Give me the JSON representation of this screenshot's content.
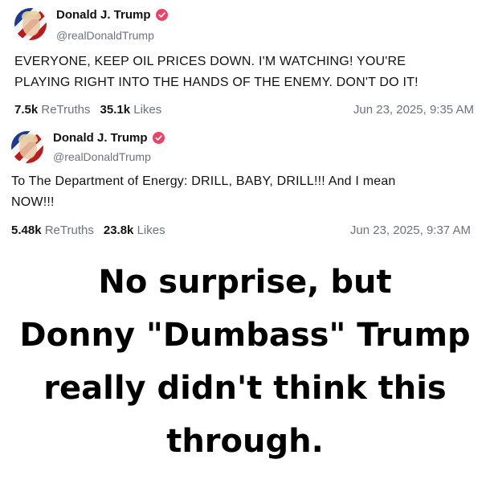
{
  "posts": [
    {
      "display_name": "Donald J. Trump",
      "handle": "@realDonaldTrump",
      "body_line1": "EVERYONE, KEEP OIL PRICES DOWN. I'M WATCHING! YOU'RE",
      "body_line2": "PLAYING RIGHT INTO THE HANDS OF THE ENEMY. DON'T DO IT!",
      "retruths_count": "7.5k",
      "retruths_label": "ReTruths",
      "likes_count": "35.1k",
      "likes_label": "Likes",
      "timestamp": "Jun 23, 2025, 9:35 AM"
    },
    {
      "display_name": "Donald J. Trump",
      "handle": "@realDonaldTrump",
      "body_line1": "To The Department of Energy: DRILL, BABY, DRILL!!!  And I mean",
      "body_line2": "NOW!!!",
      "retruths_count": "5.48k",
      "retruths_label": "ReTruths",
      "likes_count": "23.8k",
      "likes_label": "Likes",
      "timestamp": "Jun 23, 2025, 9:37 AM"
    }
  ],
  "caption": {
    "line1": "No surprise, but",
    "line2": "Donny \"Dumbass\" Trump",
    "line3": "really didn't think this",
    "line4": "through."
  },
  "colors": {
    "verified_badge": "#e8446a",
    "muted_text": "#6b7280"
  },
  "icons": {
    "verified": "verified-badge-icon",
    "avatar": "avatar"
  }
}
